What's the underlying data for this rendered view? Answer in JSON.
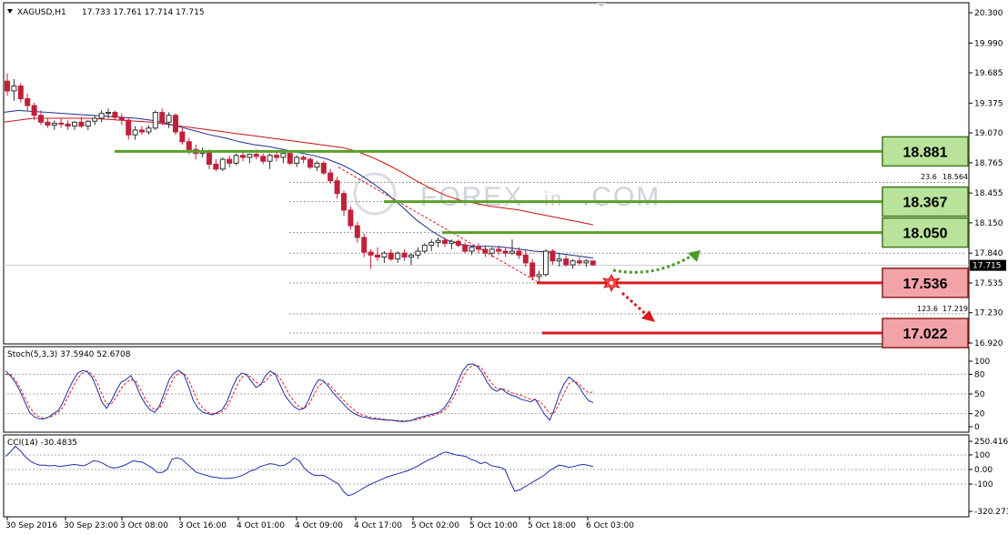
{
  "header": {
    "symbol": "XAGUSD,H1",
    "ohlc": "17.733 17.761 17.714 17.715"
  },
  "watermark": "FOREX",
  "watermark2": "in",
  "watermark3": ".COM",
  "colors": {
    "bull": "#2f2f2f",
    "bear": "#c0203a",
    "ma_fast": "#1f2e8c",
    "ma_slow": "#cc1111",
    "resistance": "#5aa02c",
    "support": "#d81b1b",
    "res_box": "#b9e39a",
    "sup_box": "#f3a3a8"
  },
  "price_axis": {
    "ticks": [
      "20.300",
      "19.990",
      "19.685",
      "19.375",
      "19.070",
      "18.765",
      "18.455",
      "18.150",
      "17.840",
      "17.535",
      "17.230",
      "16.920"
    ],
    "current": "17.715"
  },
  "time_axis": {
    "labels": [
      "30 Sep 2016",
      "30 Sep 23:00",
      "3 Oct 08:00",
      "3 Oct 16:00",
      "4 Oct 01:00",
      "4 Oct 09:00",
      "4 Oct 17:00",
      "5 Oct 02:00",
      "5 Oct 10:00",
      "5 Oct 18:00",
      "6 Oct 03:00"
    ]
  },
  "levels": {
    "resistance": [
      "18.881",
      "18.367",
      "18.050"
    ],
    "support": [
      "17.536",
      "17.022"
    ]
  },
  "fib": {
    "top_label": "23.6",
    "top_value": "18.564",
    "bottom_label": "123.6",
    "bottom_value": "17.219"
  },
  "stoch": {
    "label": "Stoch(5,3,3) 37.5940 52.6708",
    "ticks": [
      "100",
      "80",
      "50",
      "20",
      "0"
    ]
  },
  "cci": {
    "label": "CCI(14) -30.4835",
    "ticks": [
      "250.4168",
      "100",
      "0.00",
      "-100",
      "-320.273"
    ]
  },
  "chart_data": {
    "type": "candlestick",
    "symbol": "XAGUSD",
    "timeframe": "H1",
    "ylim": [
      16.85,
      20.35
    ],
    "ohlc": [
      [
        19.6,
        19.68,
        19.45,
        19.5
      ],
      [
        19.5,
        19.62,
        19.4,
        19.55
      ],
      [
        19.55,
        19.58,
        19.38,
        19.42
      ],
      [
        19.42,
        19.47,
        19.3,
        19.35
      ],
      [
        19.35,
        19.38,
        19.2,
        19.25
      ],
      [
        19.25,
        19.3,
        19.15,
        19.18
      ],
      [
        19.18,
        19.22,
        19.12,
        19.15
      ],
      [
        19.15,
        19.2,
        19.1,
        19.17
      ],
      [
        19.17,
        19.22,
        19.12,
        19.16
      ],
      [
        19.16,
        19.2,
        19.1,
        19.14
      ],
      [
        19.14,
        19.19,
        19.1,
        19.18
      ],
      [
        19.18,
        19.23,
        19.12,
        19.14
      ],
      [
        19.14,
        19.2,
        19.1,
        19.19
      ],
      [
        19.19,
        19.25,
        19.15,
        19.22
      ],
      [
        19.22,
        19.3,
        19.18,
        19.27
      ],
      [
        19.27,
        19.32,
        19.22,
        19.28
      ],
      [
        19.28,
        19.3,
        19.2,
        19.23
      ],
      [
        19.23,
        19.27,
        19.15,
        19.2
      ],
      [
        19.2,
        19.22,
        19.0,
        19.05
      ],
      [
        19.05,
        19.14,
        19.0,
        19.1
      ],
      [
        19.1,
        19.14,
        19.05,
        19.08
      ],
      [
        19.08,
        19.15,
        19.05,
        19.12
      ],
      [
        19.12,
        19.3,
        19.1,
        19.28
      ],
      [
        19.28,
        19.32,
        19.15,
        19.18
      ],
      [
        19.18,
        19.28,
        19.12,
        19.25
      ],
      [
        19.25,
        19.27,
        19.05,
        19.08
      ],
      [
        19.08,
        19.12,
        18.95,
        18.98
      ],
      [
        18.98,
        19.02,
        18.85,
        18.9
      ],
      [
        18.9,
        18.95,
        18.8,
        18.86
      ],
      [
        18.86,
        18.92,
        18.82,
        18.88
      ],
      [
        18.88,
        18.9,
        18.7,
        18.75
      ],
      [
        18.75,
        18.8,
        18.68,
        18.7
      ],
      [
        18.7,
        18.82,
        18.68,
        18.8
      ],
      [
        18.8,
        18.84,
        18.72,
        18.76
      ],
      [
        18.76,
        18.86,
        18.74,
        18.84
      ],
      [
        18.84,
        18.88,
        18.78,
        18.82
      ],
      [
        18.82,
        18.86,
        18.76,
        18.85
      ],
      [
        18.85,
        18.9,
        18.8,
        18.83
      ],
      [
        18.83,
        18.86,
        18.75,
        18.78
      ],
      [
        18.78,
        18.86,
        18.7,
        18.84
      ],
      [
        18.84,
        18.88,
        18.78,
        18.82
      ],
      [
        18.82,
        18.87,
        18.76,
        18.86
      ],
      [
        18.86,
        18.88,
        18.74,
        18.76
      ],
      [
        18.76,
        18.84,
        18.72,
        18.82
      ],
      [
        18.82,
        18.84,
        18.76,
        18.8
      ],
      [
        18.8,
        18.82,
        18.7,
        18.72
      ],
      [
        18.72,
        18.78,
        18.68,
        18.76
      ],
      [
        18.76,
        18.78,
        18.64,
        18.66
      ],
      [
        18.66,
        18.7,
        18.55,
        18.58
      ],
      [
        18.58,
        18.62,
        18.4,
        18.45
      ],
      [
        18.45,
        18.48,
        18.22,
        18.28
      ],
      [
        18.28,
        18.32,
        18.08,
        18.12
      ],
      [
        18.12,
        18.16,
        17.95,
        18.0
      ],
      [
        18.0,
        18.04,
        17.8,
        17.85
      ],
      [
        17.85,
        17.88,
        17.68,
        17.82
      ],
      [
        17.82,
        17.9,
        17.76,
        17.8
      ],
      [
        17.8,
        17.86,
        17.74,
        17.84
      ],
      [
        17.84,
        17.88,
        17.76,
        17.78
      ],
      [
        17.78,
        17.86,
        17.74,
        17.84
      ],
      [
        17.84,
        17.88,
        17.76,
        17.8
      ],
      [
        17.8,
        17.84,
        17.72,
        17.82
      ],
      [
        17.82,
        17.9,
        17.78,
        17.86
      ],
      [
        17.86,
        17.94,
        17.84,
        17.92
      ],
      [
        17.92,
        17.98,
        17.86,
        17.95
      ],
      [
        17.95,
        18.0,
        17.9,
        17.97
      ],
      [
        17.97,
        18.0,
        17.9,
        17.94
      ],
      [
        17.94,
        17.98,
        17.88,
        17.96
      ],
      [
        17.96,
        17.98,
        17.9,
        17.92
      ],
      [
        17.92,
        17.95,
        17.84,
        17.86
      ],
      [
        17.86,
        17.92,
        17.82,
        17.9
      ],
      [
        17.9,
        17.94,
        17.84,
        17.88
      ],
      [
        17.88,
        17.92,
        17.8,
        17.84
      ],
      [
        17.84,
        17.9,
        17.8,
        17.88
      ],
      [
        17.88,
        17.92,
        17.82,
        17.86
      ],
      [
        17.86,
        17.9,
        17.8,
        17.84
      ],
      [
        17.84,
        17.98,
        17.82,
        17.86
      ],
      [
        17.86,
        17.9,
        17.78,
        17.82
      ],
      [
        17.82,
        17.88,
        17.7,
        17.74
      ],
      [
        17.74,
        17.78,
        17.56,
        17.6
      ],
      [
        17.6,
        17.66,
        17.54,
        17.62
      ],
      [
        17.62,
        17.88,
        17.6,
        17.86
      ],
      [
        17.86,
        17.88,
        17.72,
        17.76
      ],
      [
        17.76,
        17.84,
        17.7,
        17.78
      ],
      [
        17.78,
        17.82,
        17.7,
        17.72
      ],
      [
        17.72,
        17.78,
        17.68,
        17.76
      ],
      [
        17.76,
        17.8,
        17.72,
        17.74
      ],
      [
        17.74,
        17.78,
        17.7,
        17.76
      ],
      [
        17.76,
        17.76,
        17.71,
        17.72
      ]
    ],
    "ma_fast": [
      19.28,
      19.3,
      19.29,
      19.28,
      19.27,
      19.26,
      19.25,
      19.24,
      19.23,
      19.22,
      19.2,
      19.17,
      19.13,
      19.09,
      19.05,
      19.02,
      18.98,
      18.95,
      18.93,
      18.9,
      18.87,
      18.84,
      18.8,
      18.74,
      18.66,
      18.56,
      18.45,
      18.32,
      18.18,
      18.07,
      17.98,
      17.93,
      17.91,
      17.91,
      17.9,
      17.88,
      17.86,
      17.85,
      17.83,
      17.81,
      17.79
    ],
    "ma_slow": [
      19.18,
      19.2,
      19.22,
      19.22,
      19.22,
      19.22,
      19.22,
      19.21,
      19.2,
      19.19,
      19.18,
      19.16,
      19.14,
      19.12,
      19.1,
      19.08,
      19.06,
      19.04,
      19.02,
      19.0,
      18.98,
      18.96,
      18.94,
      18.92,
      18.88,
      18.82,
      18.75,
      18.67,
      18.58,
      18.5,
      18.43,
      18.38,
      18.35,
      18.32,
      18.3,
      18.28,
      18.25,
      18.22,
      18.19,
      18.16,
      18.13
    ]
  },
  "stoch_data": {
    "main": [
      85,
      78,
      68,
      55,
      38,
      22,
      15,
      12,
      12,
      15,
      20,
      25,
      38,
      55,
      70,
      82,
      86,
      84,
      75,
      58,
      38,
      28,
      40,
      55,
      68,
      72,
      78,
      66,
      48,
      35,
      26,
      22,
      32,
      52,
      72,
      82,
      86,
      80,
      62,
      40,
      28,
      22,
      20,
      18,
      22,
      26,
      38,
      58,
      74,
      82,
      80,
      70,
      60,
      64,
      78,
      85,
      80,
      64,
      48,
      38,
      30,
      26,
      28,
      42,
      60,
      72,
      70,
      62,
      52,
      44,
      36,
      28,
      22,
      18,
      15,
      14,
      12,
      12,
      11,
      10,
      10,
      9,
      8,
      8,
      9,
      12,
      14,
      16,
      18,
      20,
      22,
      28,
      38,
      52,
      70,
      86,
      95,
      96,
      92,
      82,
      68,
      58,
      54,
      58,
      52,
      48,
      46,
      42,
      40,
      38,
      42,
      30,
      18,
      10,
      28,
      50,
      66,
      76,
      70,
      62,
      50,
      40,
      37
    ],
    "signal": [
      80,
      80,
      72,
      60,
      45,
      30,
      20,
      15,
      13,
      14,
      17,
      22,
      30,
      45,
      60,
      74,
      82,
      85,
      80,
      68,
      50,
      35,
      35,
      45,
      58,
      67,
      72,
      70,
      58,
      43,
      32,
      26,
      28,
      42,
      60,
      75,
      82,
      82,
      72,
      55,
      38,
      28,
      22,
      20,
      20,
      23,
      30,
      45,
      62,
      75,
      80,
      76,
      68,
      64,
      70,
      78,
      82,
      74,
      62,
      48,
      38,
      30,
      28,
      34,
      48,
      62,
      68,
      66,
      58,
      50,
      42,
      34,
      28,
      22,
      18,
      16,
      14,
      13,
      12,
      11,
      10,
      10,
      9,
      9,
      9,
      10,
      12,
      14,
      16,
      18,
      20,
      24,
      32,
      44,
      60,
      76,
      88,
      94,
      94,
      88,
      76,
      66,
      58,
      58,
      56,
      52,
      50,
      48,
      45,
      42,
      41,
      38,
      30,
      20,
      22,
      36,
      52,
      66,
      70,
      66,
      58,
      52,
      53
    ]
  },
  "cci_data": {
    "values": [
      90,
      120,
      160,
      130,
      90,
      60,
      40,
      30,
      30,
      25,
      28,
      20,
      25,
      30,
      35,
      30,
      25,
      40,
      60,
      55,
      40,
      20,
      10,
      15,
      25,
      40,
      60,
      55,
      50,
      30,
      10,
      -20,
      -20,
      0,
      70,
      80,
      70,
      40,
      10,
      -20,
      -30,
      -40,
      -50,
      -55,
      -60,
      -62,
      -60,
      -55,
      -45,
      -30,
      -10,
      0,
      20,
      30,
      40,
      35,
      25,
      30,
      50,
      80,
      60,
      10,
      -20,
      -40,
      -40,
      -40,
      -60,
      -80,
      -100,
      -150,
      -180,
      -170,
      -150,
      -130,
      -110,
      -95,
      -80,
      -65,
      -50,
      -40,
      -30,
      -20,
      -10,
      5,
      20,
      40,
      60,
      75,
      90,
      110,
      120,
      110,
      100,
      95,
      90,
      70,
      60,
      40,
      50,
      30,
      20,
      15,
      0,
      -80,
      -150,
      -140,
      -120,
      -100,
      -80,
      -60,
      -40,
      -10,
      10,
      30,
      25,
      15,
      20,
      30,
      35,
      28,
      20
    ]
  }
}
